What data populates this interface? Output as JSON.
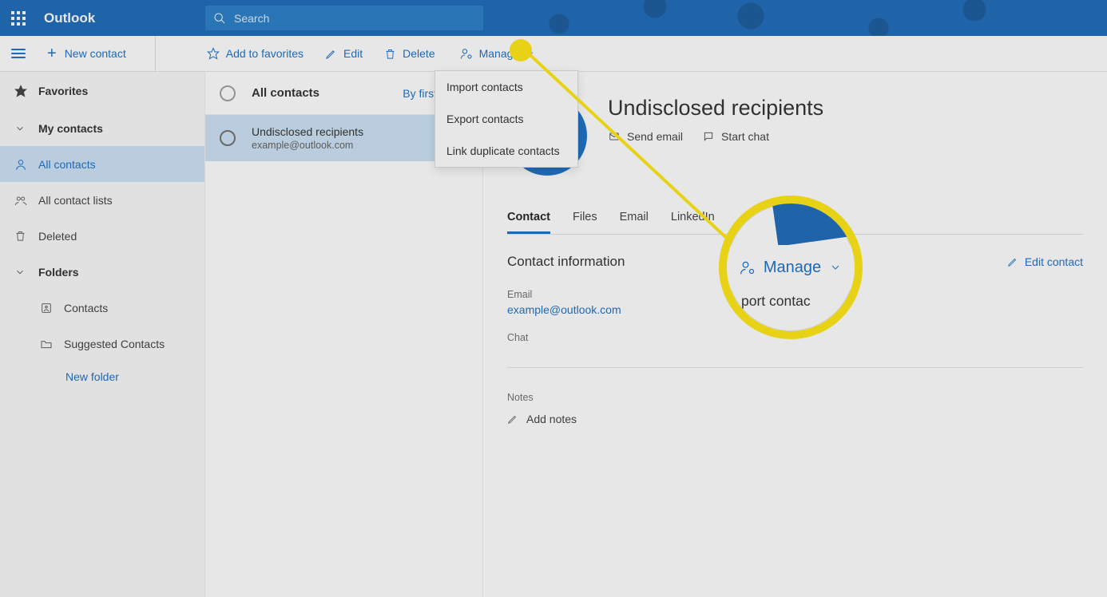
{
  "header": {
    "brand": "Outlook",
    "search_placeholder": "Search"
  },
  "toolbar": {
    "new_contact": "New contact",
    "add_fav": "Add to favorites",
    "edit": "Edit",
    "delete": "Delete",
    "manage": "Manage"
  },
  "manage_menu": {
    "import": "Import contacts",
    "export": "Export contacts",
    "link": "Link duplicate contacts"
  },
  "nav": {
    "favorites": "Favorites",
    "my_contacts": "My contacts",
    "all_contacts": "All contacts",
    "all_contact_lists": "All contact lists",
    "deleted": "Deleted",
    "folders": "Folders",
    "contacts_folder": "Contacts",
    "suggested": "Suggested Contacts",
    "new_folder": "New folder"
  },
  "list": {
    "header": "All contacts",
    "sort": "By first name",
    "items": [
      {
        "name": "Undisclosed recipients",
        "email": "example@outlook.com"
      }
    ]
  },
  "detail": {
    "title": "Undisclosed recipients",
    "send_email": "Send email",
    "start_chat": "Start chat",
    "tabs": {
      "contact": "Contact",
      "files": "Files",
      "email": "Email",
      "linkedin": "LinkedIn"
    },
    "section": "Contact information",
    "edit_contact": "Edit contact",
    "email_label": "Email",
    "email_value": "example@outlook.com",
    "chat_label": "Chat",
    "notes_label": "Notes",
    "add_notes": "Add notes"
  },
  "zoom": {
    "manage": "Manage",
    "menu_peek": "port contac"
  }
}
